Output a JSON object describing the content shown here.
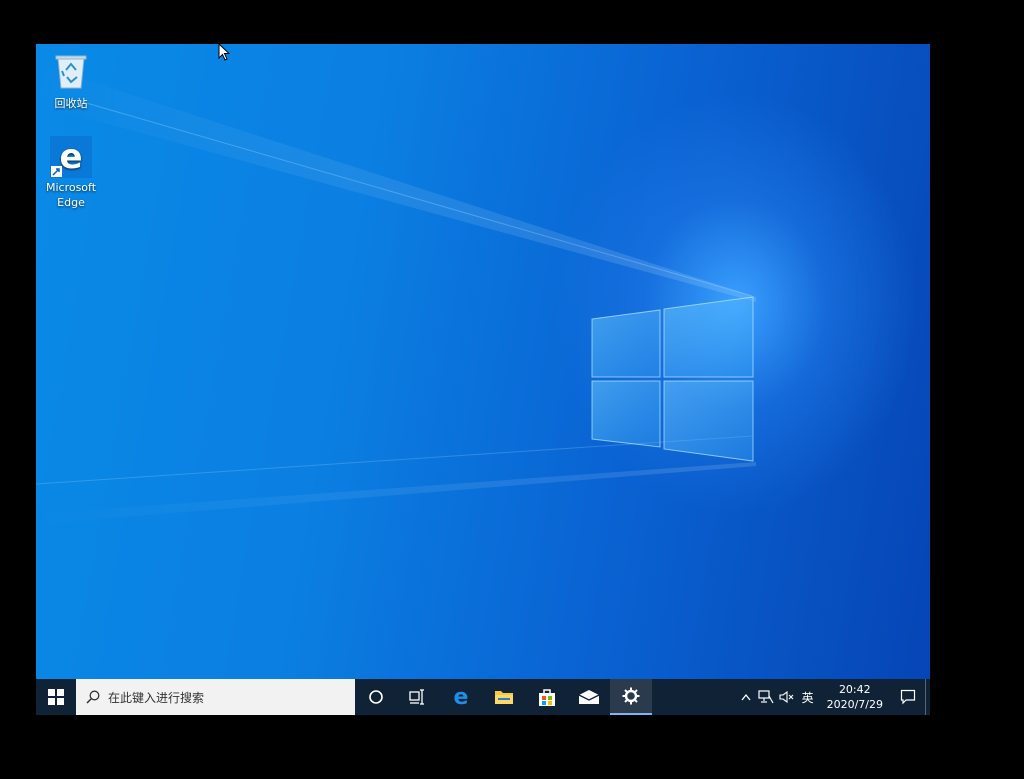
{
  "desktop": {
    "icons": [
      {
        "label": "回收站",
        "icon": "recycle-bin-icon"
      },
      {
        "label": "Microsoft Edge",
        "label_line1": "Microsoft",
        "label_line2": "Edge",
        "icon": "edge-icon"
      }
    ]
  },
  "taskbar": {
    "start_icon": "windows-start-icon",
    "search_placeholder": "在此键入进行搜索",
    "pinned": [
      {
        "name": "cortana",
        "icon": "circle-icon"
      },
      {
        "name": "task-view",
        "icon": "task-view-icon"
      },
      {
        "name": "edge",
        "icon": "edge-icon"
      },
      {
        "name": "file-explorer",
        "icon": "folder-icon"
      },
      {
        "name": "store",
        "icon": "store-bag-icon"
      },
      {
        "name": "mail",
        "icon": "mail-icon"
      },
      {
        "name": "settings",
        "icon": "gear-icon",
        "active": true
      }
    ],
    "tray": {
      "ime": "英",
      "time": "20:42",
      "date": "2020/7/29"
    }
  },
  "colors": {
    "taskbar": "#102236",
    "wallpaper_accent": "#0a7fe2"
  }
}
